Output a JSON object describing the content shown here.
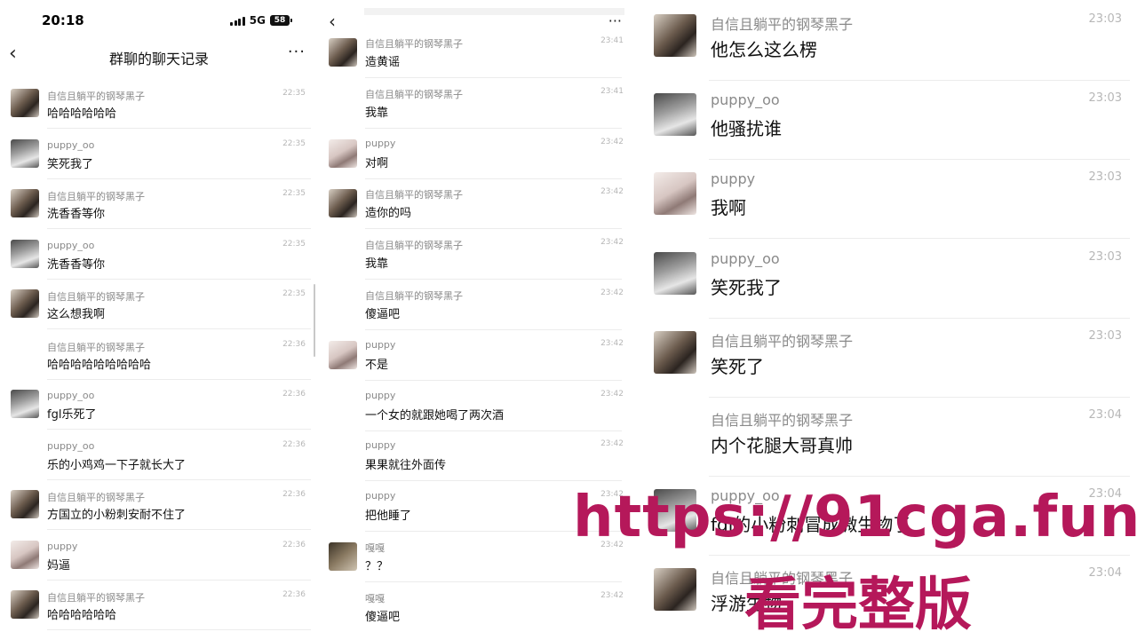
{
  "panel1": {
    "status_time": "20:18",
    "network": "5G",
    "battery": "58",
    "title": "群聊的聊天记录",
    "back_icon": "chevron-left-icon",
    "more_icon": "more-dots-icon",
    "messages": [
      {
        "nick": "自信且躺平的钢琴黑子",
        "text": "哈哈哈哈哈哈",
        "time": "22:35"
      },
      {
        "nick": "puppy_oo",
        "text": "笑死我了",
        "time": "22:35"
      },
      {
        "nick": "自信且躺平的钢琴黑子",
        "text": "洗香香等你",
        "time": "22:35"
      },
      {
        "nick": "puppy_oo",
        "text": "洗香香等你",
        "time": "22:35"
      },
      {
        "nick": "自信且躺平的钢琴黑子",
        "text": "这么想我啊",
        "time": "22:35"
      },
      {
        "nick": "自信且躺平的钢琴黑子",
        "text": "哈哈哈哈哈哈哈哈哈",
        "time": "22:36"
      },
      {
        "nick": "puppy_oo",
        "text": "fgl乐死了",
        "time": "22:36"
      },
      {
        "nick": "puppy_oo",
        "text": "乐的小鸡鸡一下子就长大了",
        "time": "22:36"
      },
      {
        "nick": "自信且躺平的钢琴黑子",
        "text": "方国立的小粉刺安耐不住了",
        "time": "22:36"
      },
      {
        "nick": "puppy",
        "text": "妈逼",
        "time": "22:36"
      },
      {
        "nick": "自信且躺平的钢琴黑子",
        "text": "哈哈哈哈哈哈",
        "time": "22:36"
      }
    ]
  },
  "panel2": {
    "back_icon": "chevron-left-icon",
    "more_icon": "more-dots-icon",
    "messages": [
      {
        "nick": "自信且躺平的钢琴黑子",
        "text": "造黄谣",
        "time": "23:41"
      },
      {
        "nick": "自信且躺平的钢琴黑子",
        "text": "我靠",
        "time": "23:41"
      },
      {
        "nick": "puppy",
        "text": "对啊",
        "time": "23:42"
      },
      {
        "nick": "自信且躺平的钢琴黑子",
        "text": "造你的吗",
        "time": "23:42"
      },
      {
        "nick": "自信且躺平的钢琴黑子",
        "text": "我靠",
        "time": "23:42"
      },
      {
        "nick": "自信且躺平的钢琴黑子",
        "text": "傻逼吧",
        "time": "23:42"
      },
      {
        "nick": "puppy",
        "text": "不是",
        "time": "23:42"
      },
      {
        "nick": "puppy",
        "text": "一个女的就跟她喝了两次酒",
        "time": "23:42"
      },
      {
        "nick": "puppy",
        "text": "果果就往外面传",
        "time": "23:42"
      },
      {
        "nick": "puppy",
        "text": "把他睡了",
        "time": "23:42"
      },
      {
        "nick": "嘎嘎",
        "text": "？？",
        "time": "23:42"
      },
      {
        "nick": "嘎嘎",
        "text": "傻逼吧",
        "time": "23:42"
      }
    ]
  },
  "panel3": {
    "messages": [
      {
        "nick": "自信且躺平的钢琴黑子",
        "text": "他怎么这么楞",
        "time": "23:03"
      },
      {
        "nick": "puppy_oo",
        "text": "他骚扰谁",
        "time": "23:03"
      },
      {
        "nick": "puppy",
        "text": "我啊",
        "time": "23:03"
      },
      {
        "nick": "puppy_oo",
        "text": "笑死我了",
        "time": "23:03"
      },
      {
        "nick": "自信且躺平的钢琴黑子",
        "text": "笑死了",
        "time": "23:03"
      },
      {
        "nick": "自信且躺平的钢琴黑子",
        "text": "内个花腿大哥真帅",
        "time": "23:04"
      },
      {
        "nick": "puppy_oo",
        "text": "fgl的小粉刺冒成微生物了",
        "time": "23:04"
      },
      {
        "nick": "自信且躺平的钢琴黑子",
        "text": "浮游生物",
        "time": "23:04"
      }
    ]
  },
  "watermark": {
    "url": "https://91cga.fun",
    "caption": "看完整版",
    "color": "#b5185a"
  }
}
